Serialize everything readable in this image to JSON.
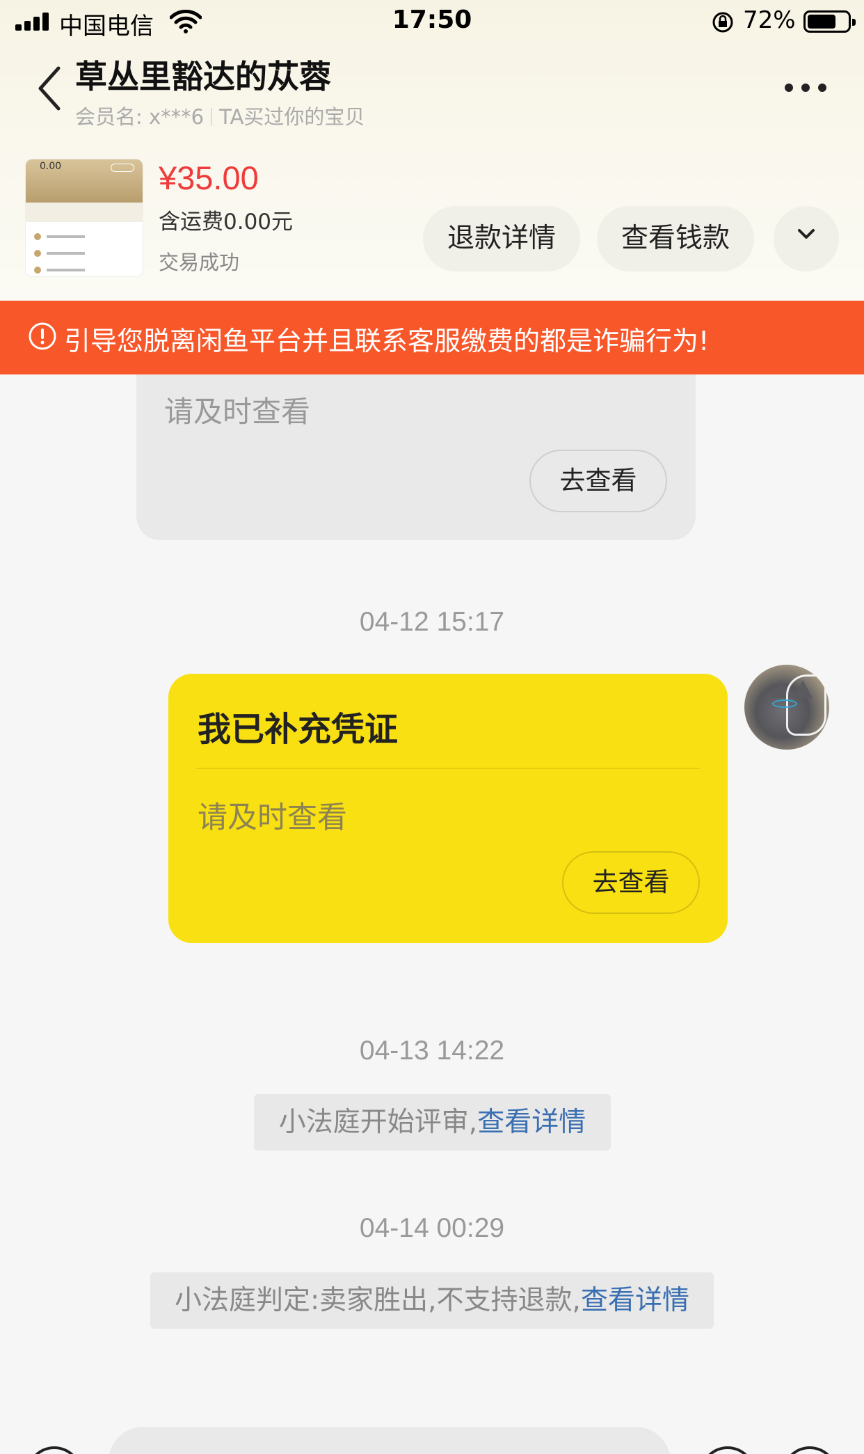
{
  "status_bar": {
    "carrier": "中国电信",
    "time": "17:50",
    "battery_pct": "72%",
    "battery_level": 0.72,
    "icons": [
      "signal-icon",
      "wifi-icon",
      "rotation-lock-icon",
      "battery-icon"
    ]
  },
  "header": {
    "title": "草丛里豁达的苁蓉",
    "member_label": "会员名:",
    "member_id": "x***6",
    "relation": "TA买过你的宝贝",
    "icons": [
      "back-icon",
      "more-icon"
    ]
  },
  "product": {
    "thumb_balance": "0.00",
    "price": "¥35.00",
    "shipping": "含运费0.00元",
    "status": "交易成功",
    "buttons": {
      "refund_detail": "退款详情",
      "view_money": "查看钱款"
    },
    "icons": [
      "chevron-down-icon"
    ]
  },
  "banner": {
    "text": "引导您脱离闲鱼平台并且联系客服缴费的都是诈骗行为!",
    "color": "#f8572a",
    "icons": [
      "warning-icon"
    ]
  },
  "messages": {
    "partial_card": {
      "hint": "请及时查看",
      "button": "去查看"
    },
    "ts1": "04-12 15:17",
    "evidence_card": {
      "title": "我已补充凭证",
      "hint": "请及时查看",
      "button": "去查看",
      "color": "#f8e012"
    },
    "ts2": "04-13 14:22",
    "sys1": {
      "text": "小法庭开始评审,",
      "link": "查看详情"
    },
    "ts3": "04-14 00:29",
    "sys2": {
      "text": "小法庭判定:卖家胜出,不支持退款,",
      "link": "查看详情"
    }
  },
  "colors": {
    "price": "#ee3b3b",
    "link": "#3a6fb2",
    "page_bg": "#f6f6f6"
  }
}
